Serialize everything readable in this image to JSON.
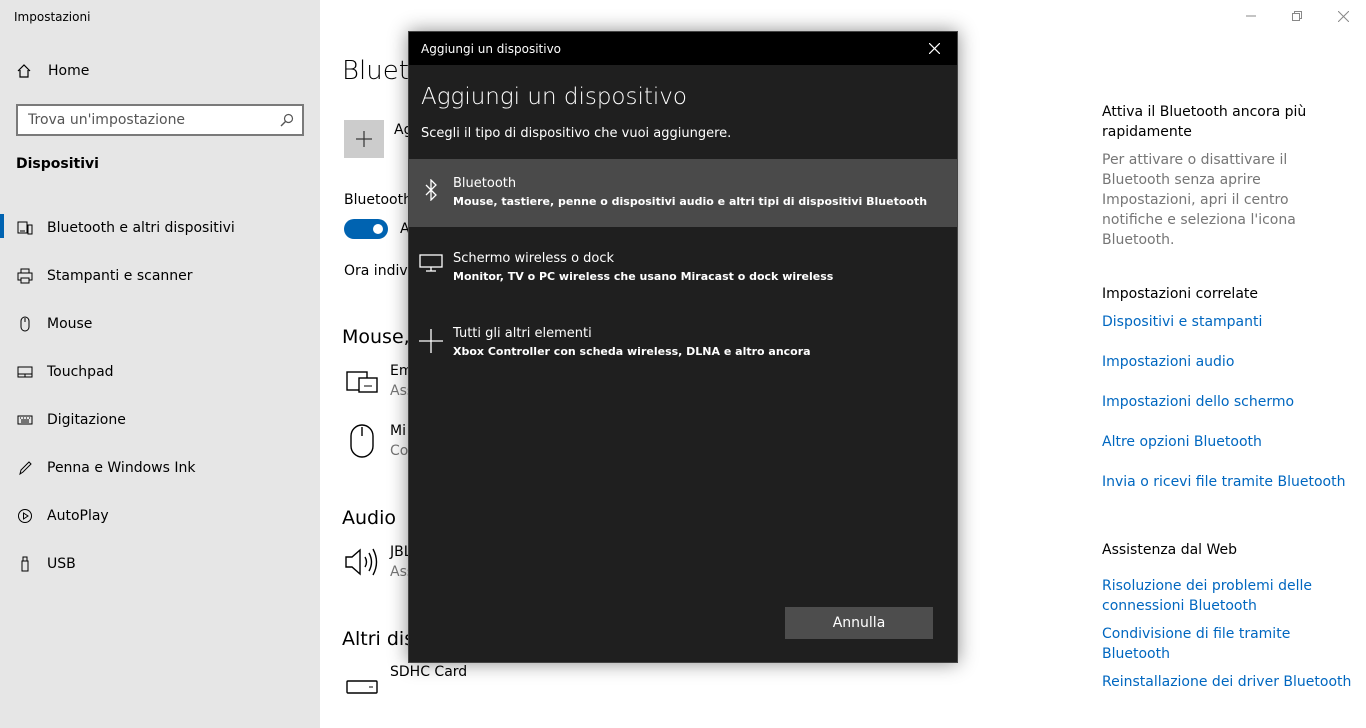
{
  "window": {
    "title": "Impostazioni"
  },
  "sidebar": {
    "home_label": "Home",
    "search_placeholder": "Trova un'impostazione",
    "section_title": "Dispositivi",
    "items": [
      {
        "label": "Bluetooth e altri dispositivi",
        "icon": "bluetooth-devices-icon"
      },
      {
        "label": "Stampanti e scanner",
        "icon": "printer-icon"
      },
      {
        "label": "Mouse",
        "icon": "mouse-icon"
      },
      {
        "label": "Touchpad",
        "icon": "touchpad-icon"
      },
      {
        "label": "Digitazione",
        "icon": "keyboard-icon"
      },
      {
        "label": "Penna e Windows Ink",
        "icon": "pen-icon"
      },
      {
        "label": "AutoPlay",
        "icon": "autoplay-icon"
      },
      {
        "label": "USB",
        "icon": "usb-icon"
      }
    ]
  },
  "main": {
    "page_title": "Blueto",
    "add_label": "Ag",
    "bluetooth_label": "Bluetooth",
    "toggle_label": "A",
    "discover_text": "Ora indivi",
    "section_mouse": "Mouse,",
    "device_1": {
      "name": "Em",
      "status": "Ass"
    },
    "device_2": {
      "name": "Mi",
      "status": "Co"
    },
    "section_audio": "Audio",
    "device_3": {
      "name": "JBL",
      "status": "Ass"
    },
    "section_other": "Altri dis",
    "device_4": {
      "name": "SDHC Card"
    }
  },
  "right": {
    "quick_title": "Attiva il Bluetooth ancora più rapidamente",
    "quick_text": "Per attivare o disattivare il Bluetooth senza aprire Impostazioni, apri il centro notifiche e seleziona l'icona Bluetooth.",
    "related_title": "Impostazioni correlate",
    "related_links": [
      "Dispositivi e stampanti",
      "Impostazioni audio",
      "Impostazioni dello schermo",
      "Altre opzioni Bluetooth",
      "Invia o ricevi file tramite Bluetooth"
    ],
    "web_title": "Assistenza dal Web",
    "web_links": [
      "Risoluzione dei problemi delle connessioni Bluetooth",
      "Condivisione di file tramite Bluetooth",
      "Reinstallazione dei driver Bluetooth"
    ]
  },
  "dialog": {
    "titlebar": "Aggiungi un dispositivo",
    "heading": "Aggiungi un dispositivo",
    "description": "Scegli il tipo di dispositivo che vuoi aggiungere.",
    "options": [
      {
        "title": "Bluetooth",
        "desc": "Mouse, tastiere, penne o dispositivi audio e altri tipi di dispositivi Bluetooth"
      },
      {
        "title": "Schermo wireless o dock",
        "desc": "Monitor, TV o PC wireless che usano Miracast o dock wireless"
      },
      {
        "title": "Tutti gli altri elementi",
        "desc": "Xbox Controller con scheda wireless, DLNA e altro ancora"
      }
    ],
    "cancel_label": "Annulla"
  },
  "colors": {
    "accent": "#0063b1",
    "link": "#0067c0",
    "dialog_bg": "#1f1f1f",
    "selected_bg": "#4a4a4a"
  }
}
